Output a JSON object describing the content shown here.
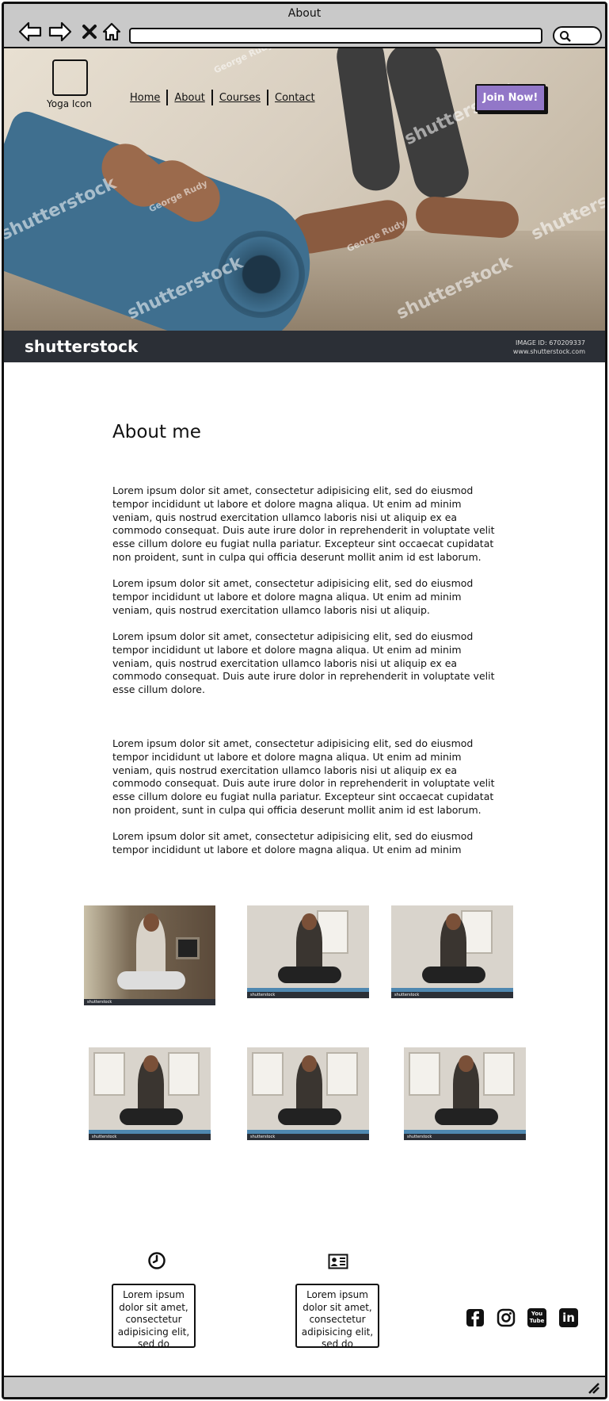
{
  "window": {
    "title": "About"
  },
  "header": {
    "logo_label": "Yoga Icon",
    "nav": [
      "Home",
      "About",
      "Courses",
      "Contact"
    ],
    "cta_label": "Join Now!"
  },
  "hero": {
    "stock_brand": "shutterstock",
    "image_id_label": "IMAGE ID:",
    "image_id": "670209337",
    "stock_url": "www.shutterstock.com",
    "watermark": "shutterstock",
    "photographer": "George Rudy"
  },
  "main": {
    "title": "About me",
    "paragraphs": [
      "Lorem ipsum dolor sit amet, consectetur adipisicing elit, sed do eiusmod tempor incididunt ut labore et dolore magna aliqua. Ut enim ad minim veniam, quis nostrud exercitation ullamco laboris nisi ut aliquip ex ea commodo consequat. Duis aute irure dolor in reprehenderit in voluptate velit esse cillum dolore eu fugiat nulla pariatur. Excepteur sint occaecat cupidatat non proident, sunt in culpa qui officia deserunt mollit anim id est laborum.",
      "Lorem ipsum dolor sit amet, consectetur adipisicing elit, sed do eiusmod tempor incididunt ut labore et dolore magna aliqua. Ut enim ad minim veniam, quis nostrud exercitation ullamco laboris nisi ut aliquip.",
      "Lorem ipsum dolor sit amet, consectetur adipisicing elit, sed do eiusmod tempor incididunt ut labore et dolore magna aliqua. Ut enim ad minim veniam, quis nostrud exercitation ullamco laboris nisi ut aliquip ex ea commodo consequat. Duis aute irure dolor in reprehenderit in voluptate velit esse cillum dolore.",
      "Lorem ipsum dolor sit amet, consectetur adipisicing elit, sed do eiusmod tempor incididunt ut labore et dolore magna aliqua. Ut enim ad minim veniam, quis nostrud exercitation ullamco laboris nisi ut aliquip ex ea commodo consequat. Duis aute irure dolor in reprehenderit in voluptate velit esse cillum dolore eu fugiat nulla pariatur. Excepteur sint occaecat cupidatat non proident, sunt in culpa qui officia deserunt mollit anim id est laborum.",
      "Lorem ipsum dolor sit amet, consectetur adipisicing elit, sed do eiusmod tempor incididunt ut labore et dolore magna aliqua. Ut enim ad minim"
    ]
  },
  "gallery": {
    "photo_brand": "shutterstock"
  },
  "footer": {
    "cards": [
      "Lorem ipsum dolor sit amet, consectetur adipisicing elit, sed do eiusmod",
      "Lorem ipsum dolor sit amet, consectetur adipisicing elit, sed do eiusmod"
    ],
    "social_icons": [
      "facebook-icon",
      "instagram-icon",
      "youtube-icon",
      "linkedin-icon"
    ],
    "youtube_text": "You Tube",
    "linkedin_text": "in"
  },
  "colors": {
    "chrome": "#c9c9c9",
    "cta": "#9277c8",
    "stock_bar": "#2b2f36"
  }
}
